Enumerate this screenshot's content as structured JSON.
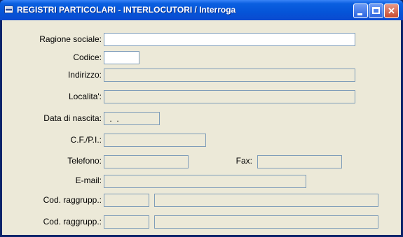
{
  "window": {
    "title": "REGISTRI PARTICOLARI - INTERLOCUTORI / Interroga",
    "minimize_icon": "minimize-icon",
    "maximize_icon": "maximize-icon",
    "close_icon": "close-icon"
  },
  "form": {
    "ragione_sociale": {
      "label": "Ragione sociale:",
      "value": ""
    },
    "codice": {
      "label": "Codice:",
      "value": ""
    },
    "indirizzo": {
      "label": "Indirizzo:",
      "value": ""
    },
    "localita": {
      "label": "Localita':",
      "value": ""
    },
    "data_nascita": {
      "label": "Data di nascita:",
      "value": " .  ."
    },
    "cf_pi": {
      "label": "C.F./P.I.:",
      "value": ""
    },
    "telefono": {
      "label": "Telefono:",
      "value": ""
    },
    "fax": {
      "label": "Fax:",
      "value": ""
    },
    "email": {
      "label": "E-mail:",
      "value": ""
    },
    "cod_raggrupp_1": {
      "label": "Cod. raggrupp.:",
      "code": "",
      "description": ""
    },
    "cod_raggrupp_2": {
      "label": "Cod. raggrupp.:",
      "code": "",
      "description": ""
    }
  }
}
